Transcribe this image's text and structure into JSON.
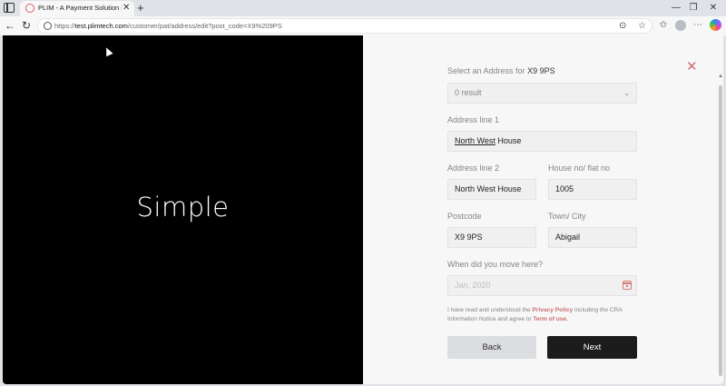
{
  "browser": {
    "tab_title": "PLIM - A Payment Solution For Th",
    "url_prefix": "https://",
    "url_host": "test.plimtech.com",
    "url_path": "/customer/pat/address/edit?post_code=X9%209PS"
  },
  "hero": {
    "text": "Simple"
  },
  "form": {
    "select_label": "Select an Address for ",
    "select_postcode": "X9 9PS",
    "select_value": "0 result",
    "address1_label": "Address line 1",
    "address1_value_underlined": "North West",
    "address1_value_rest": " House",
    "address2_label": "Address line 2",
    "address2_value": "North West House",
    "house_label": "House no/ flat no",
    "house_value": "1005",
    "postcode_label": "Postcode",
    "postcode_value": "X9 9PS",
    "town_label": "Town/ City",
    "town_value": "Abigail",
    "move_label": "When did you move here?",
    "move_placeholder": "Jan, 2020",
    "consent_1": "I have read and understood the ",
    "consent_privacy": "Privacy Policy",
    "consent_2": " including the CRA Information Notice and agree to ",
    "consent_terms": "Term of use",
    "consent_3": ".",
    "back_label": "Back",
    "next_label": "Next"
  },
  "colors": {
    "accent": "#c97070",
    "button_dark": "#1c1c1c",
    "hero_bg": "#000000"
  },
  "icons": [
    "tab-actions-icon",
    "favicon-icon",
    "close-tab-icon",
    "new-tab-icon",
    "minimize-icon",
    "maximize-icon",
    "close-window-icon",
    "back-icon",
    "refresh-icon",
    "lock-icon",
    "reader-icon",
    "star-icon",
    "favorites-icon",
    "profile-icon",
    "menu-icon",
    "copilot-icon",
    "chevron-down-icon",
    "calendar-icon",
    "close-icon"
  ]
}
